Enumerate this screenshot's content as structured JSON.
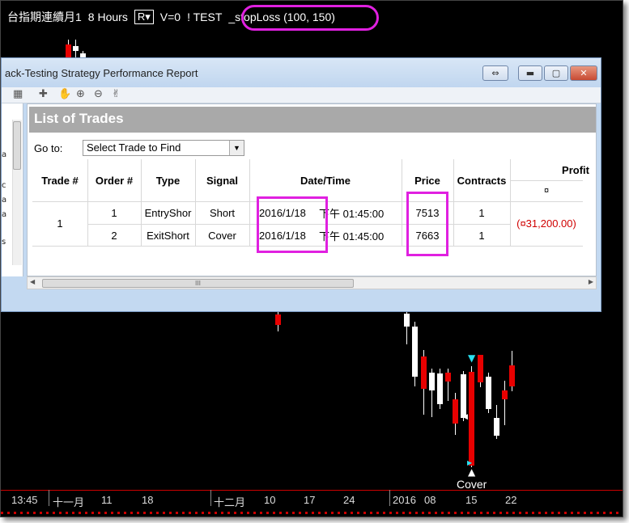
{
  "chart": {
    "header": {
      "symbol": "台指期連續月1",
      "interval": "8 Hours",
      "r_label": "R▾",
      "v_label": "V=0",
      "strategy": "! TEST",
      "stoploss": "_stopLoss (100,  150)"
    },
    "cover_marker": "Cover",
    "axis_labels": [
      "13:45",
      "十一月",
      "11",
      "18",
      "十二月",
      "10",
      "17",
      "24",
      "2016",
      "08",
      "15",
      "22"
    ]
  },
  "report": {
    "title": "ack-Testing Strategy Performance Report",
    "section_title": "List of Trades",
    "goto_label": "Go to:",
    "goto_value": "Select Trade to Find",
    "columns": {
      "trade": "Trade #",
      "order": "Order #",
      "type": "Type",
      "signal": "Signal",
      "datetime": "Date/Time",
      "price": "Price",
      "contracts": "Contracts",
      "profit": "Profit",
      "profit_sub": "¤"
    },
    "trade_number": "1",
    "trade_profit": "(¤31,200.00)",
    "rows": [
      {
        "order": "1",
        "type": "EntryShor",
        "signal": "Short",
        "date": "2016/1/18",
        "time": "下午 01:45:00",
        "price": "7513",
        "contracts": "1"
      },
      {
        "order": "2",
        "type": "ExitShort",
        "signal": "Cover",
        "date": "2016/1/18",
        "time": "下午 01:45:00",
        "price": "7663",
        "contracts": "1"
      }
    ],
    "left_pane_chars": [
      "a",
      "c",
      "a",
      "a",
      "s"
    ],
    "scroll_grip": "III"
  },
  "colors": {
    "highlight": "#e020e0",
    "candle_red": "#e80000",
    "loss_text": "#d00000",
    "marker_cyan": "#29e0f0"
  }
}
